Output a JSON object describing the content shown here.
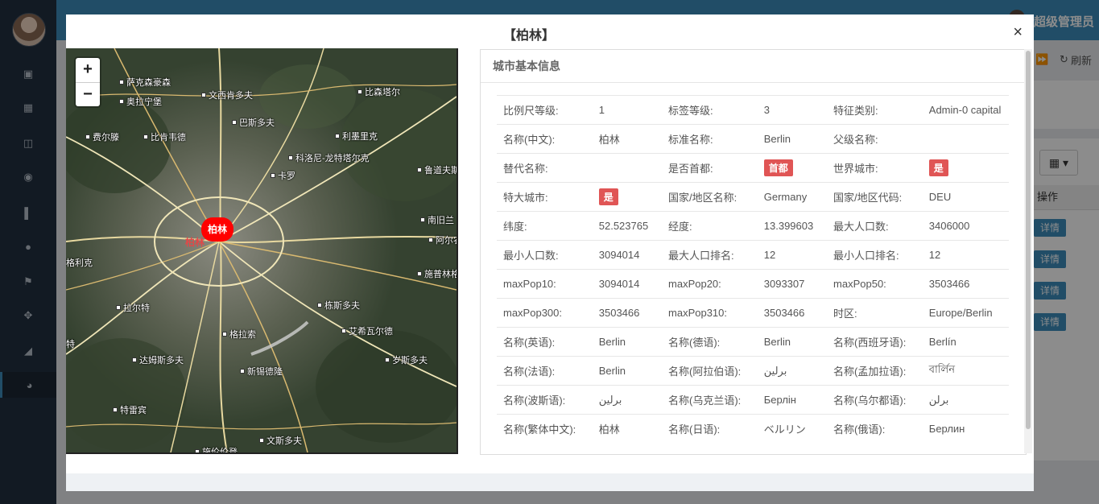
{
  "app": {
    "user_name": "超级管理员",
    "refresh_label": "刷新",
    "table_header_op": "操作",
    "detail_btn": "详情"
  },
  "modal": {
    "title": "【柏林】",
    "close_label": "×"
  },
  "map": {
    "zoom_in": "+",
    "zoom_out": "−",
    "marker_label": "柏林",
    "places": [
      "萨克森豪森",
      "奥拉宁堡",
      "文西肯多夫",
      "比森塔尔",
      "巴斯多夫",
      "费尔滕",
      "比肯韦德",
      "利墨里克",
      "科洛尼-龙特塔尔克",
      "卡罗",
      "鲁道夫斯",
      "南旧兰",
      "阿尔农",
      "施普林格",
      "格利克",
      "拉尔特",
      "栋斯多夫",
      "艾希瓦尔德",
      "格拉索",
      "特",
      "达姆斯多夫",
      "岁斯多夫",
      "新锡德隆",
      "特雷宾",
      "文斯多夫",
      "施伦伦登"
    ]
  },
  "info": {
    "section_title": "城市基本信息",
    "rows": [
      [
        {
          "k": "比例尺等级:",
          "v": "1"
        },
        {
          "k": "标签等级:",
          "v": "3"
        },
        {
          "k": "特征类别:",
          "v": "Admin-0 capital"
        }
      ],
      [
        {
          "k": "名称(中文):",
          "v": "柏林"
        },
        {
          "k": "标准名称:",
          "v": "Berlin"
        },
        {
          "k": "父级名称:",
          "v": ""
        }
      ],
      [
        {
          "k": "替代名称:",
          "v": ""
        },
        {
          "k": "是否首都:",
          "v": "首都",
          "badge": true
        },
        {
          "k": "世界城市:",
          "v": "是",
          "badge": true
        }
      ],
      [
        {
          "k": "特大城市:",
          "v": "是",
          "badge": true
        },
        {
          "k": "国家/地区名称:",
          "v": "Germany"
        },
        {
          "k": "国家/地区代码:",
          "v": "DEU"
        }
      ],
      [
        {
          "k": "纬度:",
          "v": "52.523765"
        },
        {
          "k": "经度:",
          "v": "13.399603"
        },
        {
          "k": "最大人口数:",
          "v": "3406000"
        }
      ],
      [
        {
          "k": "最小人口数:",
          "v": "3094014"
        },
        {
          "k": "最大人口排名:",
          "v": "12"
        },
        {
          "k": "最小人口排名:",
          "v": "12"
        }
      ],
      [
        {
          "k": "maxPop10:",
          "v": "3094014"
        },
        {
          "k": "maxPop20:",
          "v": "3093307"
        },
        {
          "k": "maxPop50:",
          "v": "3503466"
        }
      ],
      [
        {
          "k": "maxPop300:",
          "v": "3503466"
        },
        {
          "k": "maxPop310:",
          "v": "3503466"
        },
        {
          "k": "时区:",
          "v": "Europe/Berlin"
        }
      ],
      [
        {
          "k": "名称(英语):",
          "v": "Berlin"
        },
        {
          "k": "名称(德语):",
          "v": "Berlin"
        },
        {
          "k": "名称(西班牙语):",
          "v": "Berlín"
        }
      ],
      [
        {
          "k": "名称(法语):",
          "v": "Berlin"
        },
        {
          "k": "名称(阿拉伯语):",
          "v": "برلين"
        },
        {
          "k": "名称(孟加拉语):",
          "v": "বার্লিন"
        }
      ],
      [
        {
          "k": "名称(波斯语):",
          "v": "برلین"
        },
        {
          "k": "名称(乌克兰语):",
          "v": "Берлін"
        },
        {
          "k": "名称(乌尔都语):",
          "v": "برلن"
        }
      ],
      [
        {
          "k": "名称(繁体中文):",
          "v": "柏林"
        },
        {
          "k": "名称(日语):",
          "v": "ベルリン"
        },
        {
          "k": "名称(俄语):",
          "v": "Берлин"
        }
      ]
    ]
  },
  "colors": {
    "badge": "#e05555",
    "topbar": "#3c8dbc",
    "sidebar": "#223040",
    "marker": "#ff0000"
  }
}
